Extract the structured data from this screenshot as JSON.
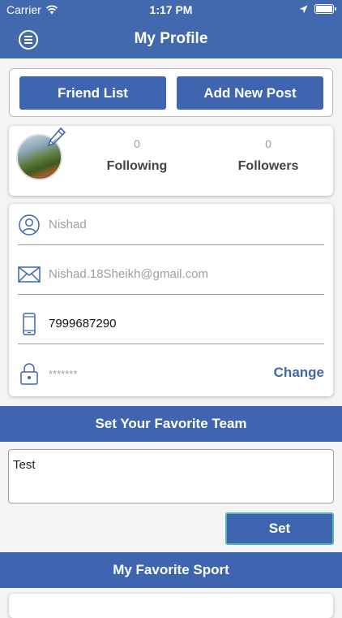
{
  "status_bar": {
    "carrier": "Carrier",
    "time": "1:17 PM"
  },
  "header": {
    "title": "My Profile",
    "menu_icon": "hamburger-circle-icon"
  },
  "actions": {
    "friend_list": "Friend List",
    "add_new_post": "Add New Post"
  },
  "stats": {
    "following": {
      "count": "0",
      "label": "Following"
    },
    "followers": {
      "count": "0",
      "label": "Followers"
    }
  },
  "profile": {
    "name": "Nishad",
    "email": "Nishad.18Sheikh@gmail.com",
    "phone": "7999687290",
    "password": "*******",
    "change_label": "Change"
  },
  "favorite_team": {
    "header": "Set Your Favorite Team",
    "input_value": "Test",
    "set_label": "Set"
  },
  "favorite_sport": {
    "header": "My Favorite Sport"
  },
  "colors": {
    "primary": "#3f65b0",
    "header": "#4268ad",
    "accent_border": "#4fb5b0",
    "background": "#f4f4f6"
  }
}
